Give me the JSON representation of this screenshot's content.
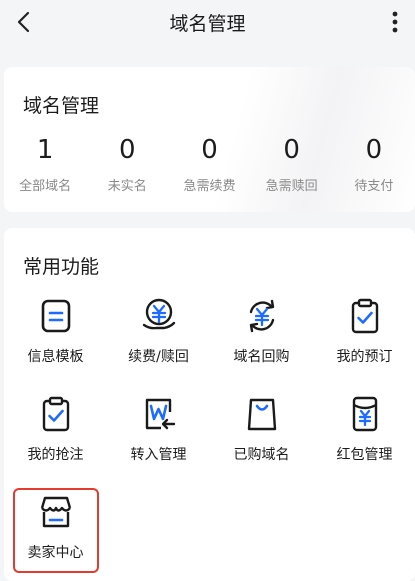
{
  "header": {
    "title": "域名管理"
  },
  "summary": {
    "title": "域名管理",
    "stats": [
      {
        "value": "1",
        "label": "全部域名"
      },
      {
        "value": "0",
        "label": "未实名"
      },
      {
        "value": "0",
        "label": "急需续费"
      },
      {
        "value": "0",
        "label": "急需赎回"
      },
      {
        "value": "0",
        "label": "待支付"
      }
    ]
  },
  "features": {
    "title": "常用功能",
    "items": [
      {
        "label": "信息模板",
        "icon": "template-icon"
      },
      {
        "label": "续费/赎回",
        "icon": "renew-yuan-icon"
      },
      {
        "label": "域名回购",
        "icon": "buyback-yuan-icon"
      },
      {
        "label": "我的预订",
        "icon": "clipboard-check-icon"
      },
      {
        "label": "我的抢注",
        "icon": "clipboard-check-icon"
      },
      {
        "label": "转入管理",
        "icon": "transfer-w-icon"
      },
      {
        "label": "已购域名",
        "icon": "shopping-bag-icon"
      },
      {
        "label": "红包管理",
        "icon": "red-envelope-icon"
      },
      {
        "label": "卖家中心",
        "icon": "storefront-icon"
      }
    ]
  },
  "colors": {
    "accent": "#1e6bff",
    "highlight": "#e63a2e"
  }
}
